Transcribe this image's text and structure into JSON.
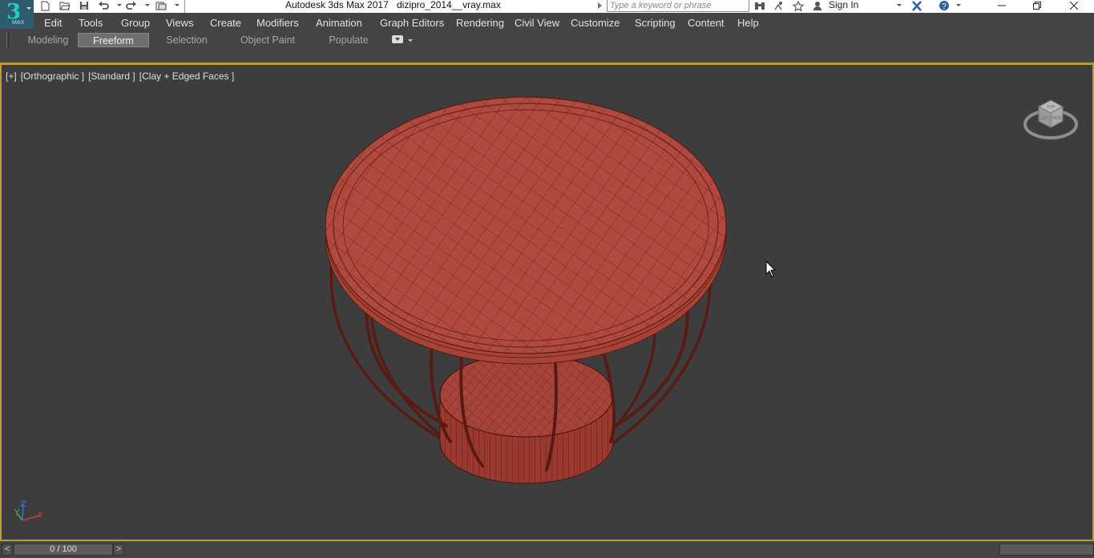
{
  "titlebar": {
    "app_title": "Autodesk 3ds Max 2017",
    "file_name": "dizipro_2014__vray.max",
    "search_placeholder": "Type a keyword or phrase",
    "sign_in": "Sign In",
    "logo_text": "3",
    "logo_sub": "MAX",
    "icons": [
      "new-file-icon",
      "open-file-icon",
      "save-icon",
      "undo-icon",
      "redo-icon",
      "project-folder-icon",
      "customize-quick-access-icon",
      "binoculars-icon",
      "satellite-icon",
      "favorites-star-icon",
      "user-icon",
      "autodesk-exchange-icon",
      "help-icon",
      "minimize-icon",
      "restore-icon",
      "close-icon"
    ]
  },
  "menu": {
    "items": [
      "Edit",
      "Tools",
      "Group",
      "Views",
      "Create",
      "Modifiers",
      "Animation",
      "Graph Editors",
      "Rendering",
      "Civil View",
      "Customize",
      "Scripting",
      "Content",
      "Help"
    ]
  },
  "ribbon": {
    "tabs": [
      "Modeling",
      "Freeform",
      "Selection",
      "Object Paint",
      "Populate"
    ],
    "active_tab": "Freeform"
  },
  "viewport": {
    "label_parts": [
      "[+]",
      "[Orthographic ]",
      "[Standard ]",
      "[Clay + Edged Faces ]"
    ],
    "viewcube_faces": [
      "TOP",
      "FRONT",
      "LEFT"
    ],
    "object_color": "#b04a3e",
    "wire_color": "#5a1a14",
    "background_color": "#3d3d3d",
    "active_border_color": "#bd9a35"
  },
  "timeslider": {
    "prev": "<",
    "position": "0 / 100",
    "next": ">"
  }
}
